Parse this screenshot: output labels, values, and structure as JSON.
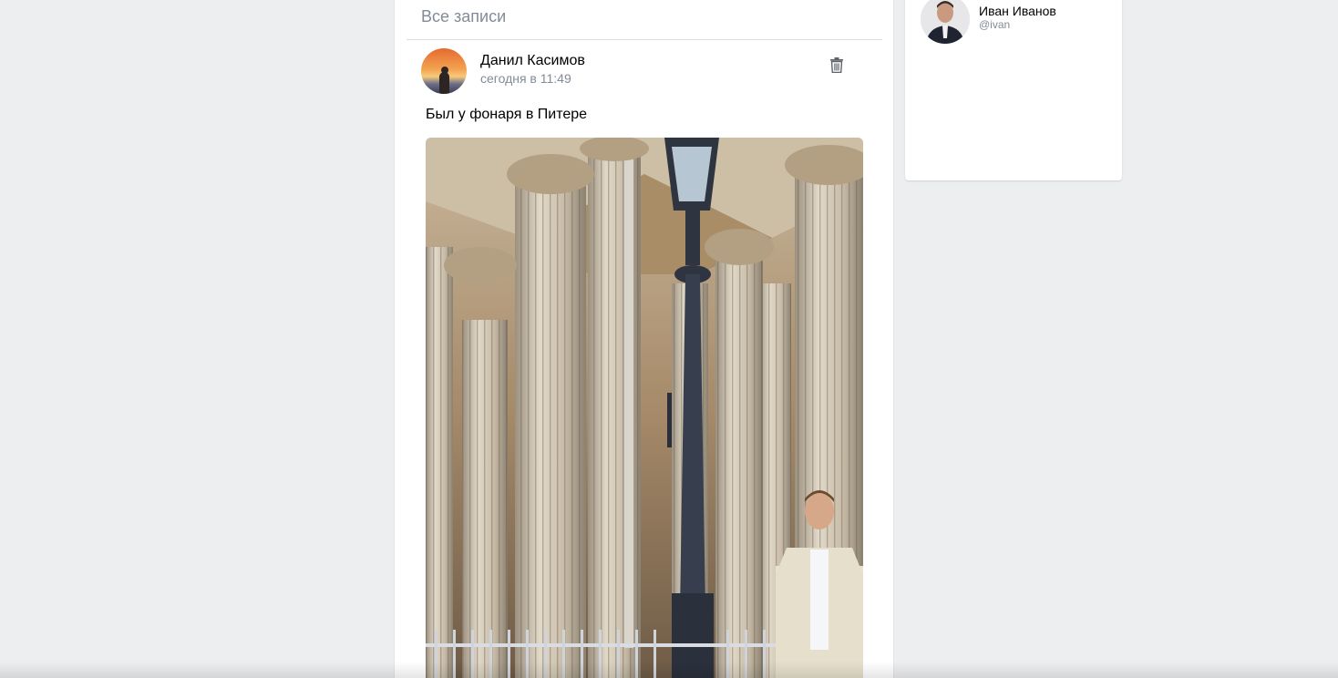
{
  "feed": {
    "title": "Все записи"
  },
  "post": {
    "author": "Данил Касимов",
    "time": "сегодня в 11:49",
    "text": "Был у фонаря в Питере",
    "avatar_icon": "avatar-sunset",
    "delete_icon": "trash-icon",
    "photo_icon": "photo-columns-lamp"
  },
  "profile": {
    "name": "Иван Иванов",
    "handle": "@ivan",
    "avatar_icon": "avatar-portrait"
  },
  "colors": {
    "background": "#edeef0",
    "card": "#ffffff",
    "muted_text": "#818c99",
    "text": "#000000"
  }
}
